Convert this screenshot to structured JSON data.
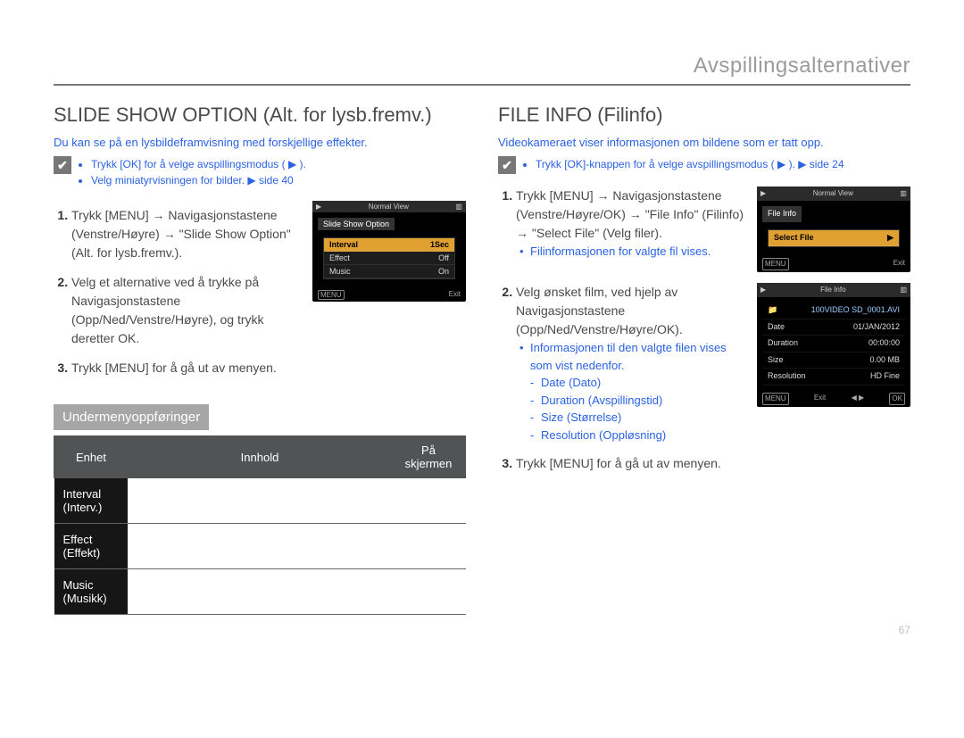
{
  "header": {
    "title": "Avspillingsalternativer"
  },
  "left": {
    "heading": "SLIDE SHOW OPTION (Alt. for lysb.fremv.)",
    "lead": "Du kan se på en lysbildeframvisning med forskjellige effekter.",
    "note1": "Trykk [OK] for å velge avspillingsmodus (  ▶  ).",
    "note2": "Velg miniatyrvisningen for bilder. ▶ side 40",
    "step1": "Trykk [MENU] → Navigasjonstastene (Venstre/Høyre) → \"Slide Show Option\" (Alt. for lysb.fremv.).",
    "step2": "Velg et alternative ved å trykke på Navigasjonstastene (Opp/Ned/Venstre/Høyre), og trykk deretter OK.",
    "step3": "Trykk [MENU] for å gå ut av menyen.",
    "submenu_heading": "Undermenyoppføringer",
    "table": {
      "h1": "Enhet",
      "h2": "Innhold",
      "h3": "På skjermen",
      "rows": [
        {
          "item": "Interval (Interv.)",
          "content": "",
          "screen": ""
        },
        {
          "item": "Effect (Effekt)",
          "content": "",
          "screen": ""
        },
        {
          "item": "Music (Musikk)",
          "content": "",
          "screen": ""
        }
      ]
    },
    "shot1": {
      "topTitle": "Normal View",
      "panel": "Slide Show Option",
      "rows": [
        {
          "label": "Interval",
          "value": "1Sec",
          "sel": true
        },
        {
          "label": "Effect",
          "value": "Off",
          "sel": false
        },
        {
          "label": "Music",
          "value": "On",
          "sel": false
        }
      ],
      "menu": "MENU",
      "exit": "Exit"
    }
  },
  "right": {
    "heading": "FILE INFO (Filinfo)",
    "lead": "Videokameraet viser informasjonen om bildene som er tatt opp.",
    "note1": "Trykk [OK]-knappen for å velge avspillingsmodus (  ▶  ). ▶ side 24",
    "step1": "Trykk [MENU] → Navigasjonstastene (Venstre/Høyre/OK) → \"File Info\" (Filinfo) → \"Select File\" (Velg filer).",
    "step1_sub": "Filinformasjonen for valgte fil vises.",
    "step2": "Velg ønsket film, ved hjelp av Navigasjonstastene (Opp/Ned/Venstre/Høyre/OK).",
    "step2_sub_lead": "Informasjonen til den valgte filen vises som vist nedenfor.",
    "step2_items": [
      "Date (Dato)",
      "Duration (Avspillingstid)",
      "Size (Størrelse)",
      "Resolution (Oppløsning)"
    ],
    "step3": "Trykk [MENU] for å gå ut av menyen.",
    "shot2": {
      "topTitle": "Normal View",
      "panel": "File Info",
      "row": "Select File",
      "menu": "MENU",
      "exit": "Exit"
    },
    "shot3": {
      "title": "File Info",
      "file": "100VIDEO   SD_0001.AVI",
      "rows": [
        {
          "k": "Date",
          "v": "01/JAN/2012"
        },
        {
          "k": "Duration",
          "v": "00:00:00"
        },
        {
          "k": "Size",
          "v": "0.00 MB"
        },
        {
          "k": "Resolution",
          "v": "HD Fine"
        }
      ],
      "menu": "MENU",
      "exit": "Exit",
      "move": "◀ ▶",
      "ok": "OK"
    }
  },
  "page_number": "67"
}
